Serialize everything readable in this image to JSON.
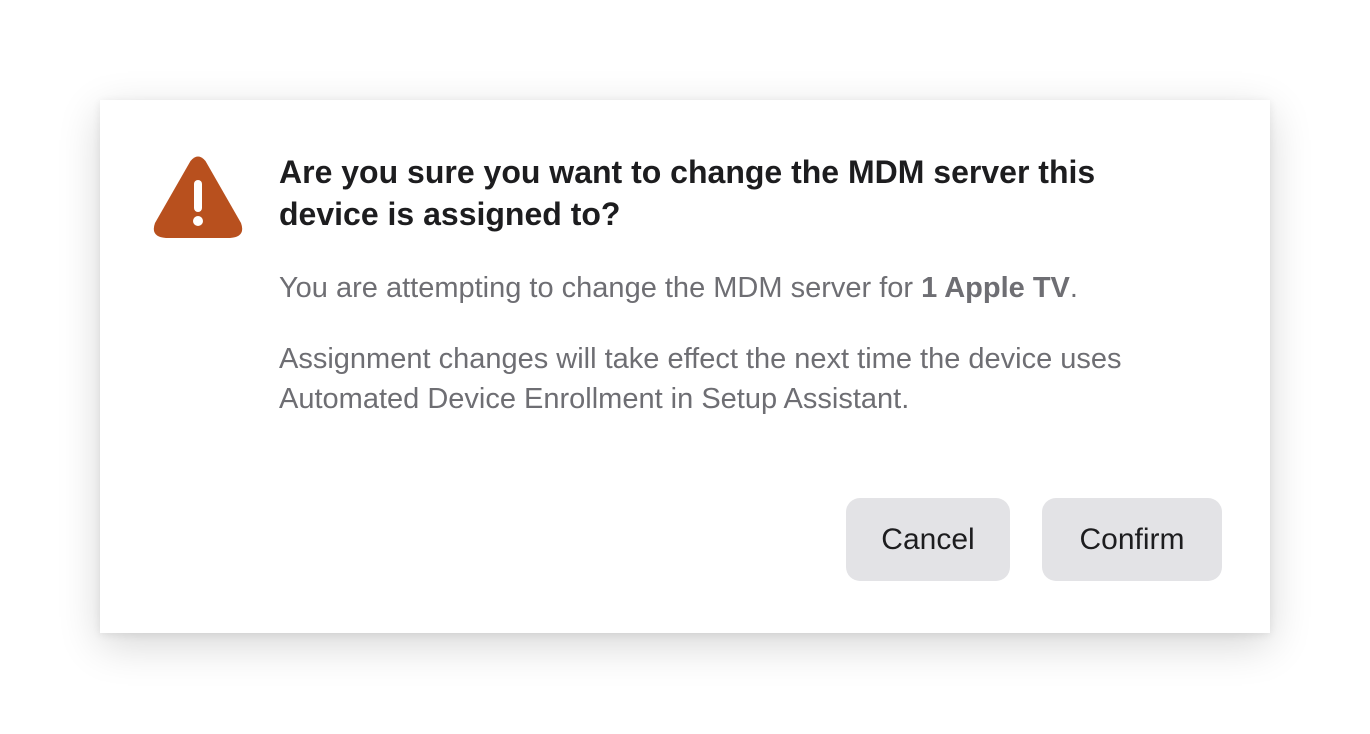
{
  "dialog": {
    "title": "Are you sure you want to change the MDM server this device is assigned to?",
    "message_prefix": "You are attempting to change the MDM server for ",
    "device_label": "1 Apple TV",
    "message_suffix": ".",
    "detail": "Assignment changes will take effect the next time the device uses Automated Device Enrollment in Setup Assistant.",
    "icon": "warning-triangle-icon",
    "icon_color": "#B8501E",
    "cancel_label": "Cancel",
    "confirm_label": "Confirm"
  }
}
